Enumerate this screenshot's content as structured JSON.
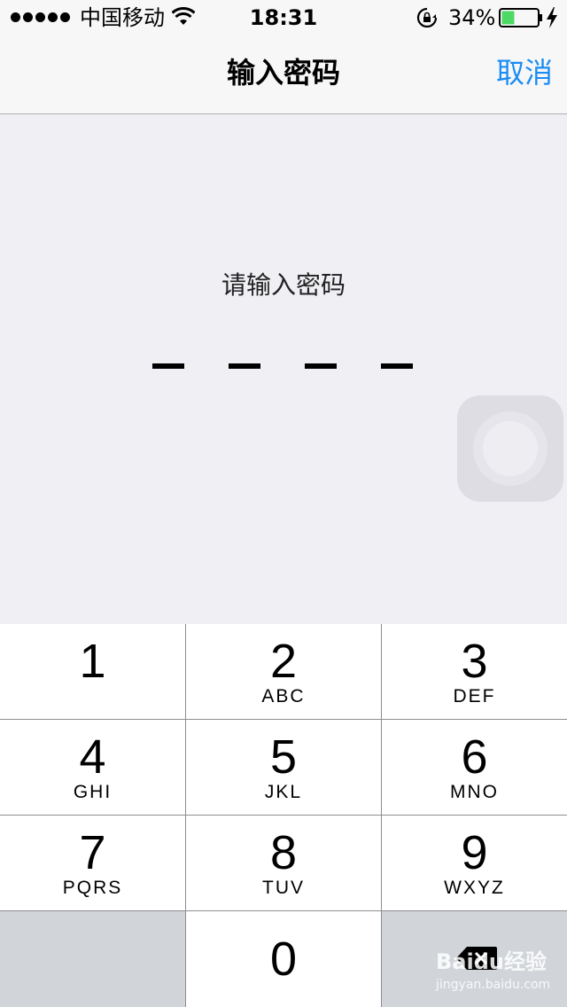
{
  "status_bar": {
    "carrier": "中国移动",
    "time": "18:31",
    "battery_percent": "34%",
    "battery_level": 0.34,
    "battery_color": "#4cd964",
    "icons": [
      "signal-dots",
      "wifi-icon",
      "rotation-lock-icon",
      "battery-icon",
      "charging-bolt-icon"
    ]
  },
  "nav": {
    "title": "输入密码",
    "cancel_label": "取消",
    "accent_color": "#1a8cf5"
  },
  "passcode": {
    "prompt": "请输入密码",
    "digits_entered": 0,
    "digits_total": 4
  },
  "keypad": {
    "keys": [
      {
        "digit": "1",
        "letters": ""
      },
      {
        "digit": "2",
        "letters": "ABC"
      },
      {
        "digit": "3",
        "letters": "DEF"
      },
      {
        "digit": "4",
        "letters": "GHI"
      },
      {
        "digit": "5",
        "letters": "JKL"
      },
      {
        "digit": "6",
        "letters": "MNO"
      },
      {
        "digit": "7",
        "letters": "PQRS"
      },
      {
        "digit": "8",
        "letters": "TUV"
      },
      {
        "digit": "9",
        "letters": "WXYZ"
      },
      {
        "digit": "0",
        "letters": ""
      }
    ],
    "delete_icon": "delete-backspace-icon"
  },
  "watermark": {
    "name": "Baidu经验",
    "url": "jingyan.baidu.com"
  }
}
